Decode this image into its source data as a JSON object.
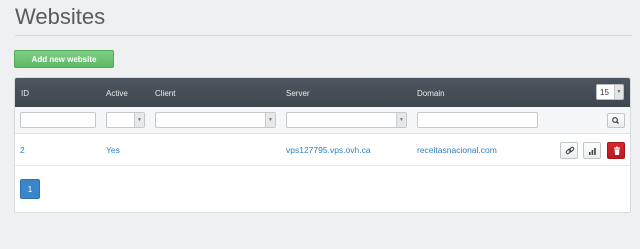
{
  "page": {
    "title": "Websites"
  },
  "toolbar": {
    "add_label": "Add new website"
  },
  "table": {
    "columns": [
      "ID",
      "Active",
      "Client",
      "Server",
      "Domain"
    ],
    "per_page": "15",
    "rows": [
      {
        "id": "2",
        "active": "Yes",
        "client": "",
        "server": "vps127795.vps.ovh.ca",
        "domain": "receitasnacional.com"
      }
    ]
  },
  "icons": [
    "search-icon",
    "link-icon",
    "signal-bars-icon",
    "trash-icon",
    "caret-down-icon"
  ],
  "colors": {
    "header_bg": "#434c55",
    "accent": "#3a86c8",
    "add_button": "#6cc475",
    "delete_button": "#c9222a",
    "link": "#2f7fc1"
  },
  "pagination": {
    "current": "1"
  }
}
